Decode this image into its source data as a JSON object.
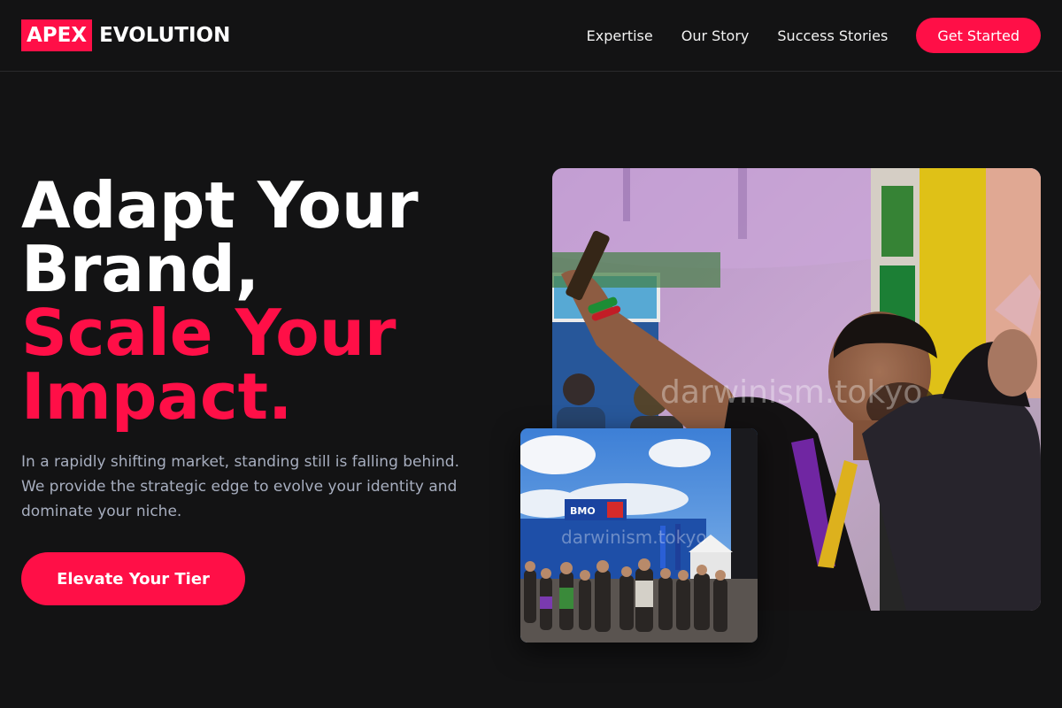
{
  "brand": {
    "badge": "APEX",
    "name": "EVOLUTION",
    "accent_color": "#ff0f47"
  },
  "nav": {
    "links": [
      "Expertise",
      "Our Story",
      "Success Stories"
    ],
    "cta": "Get Started"
  },
  "hero": {
    "title_line1": "Adapt Your",
    "title_line2": "Brand,",
    "title_line3": "Scale Your",
    "title_line4": "Impact.",
    "description": "In a rapidly shifting market, standing still is falling behind. We provide the strategic edge to evolve your identity and dominate your niche.",
    "cta": "Elevate Your Tier"
  },
  "images": {
    "main_watermark": "darwinism.tokyo",
    "sub_watermark": "darwinism.tokyo",
    "sub_sign": "BMO"
  }
}
